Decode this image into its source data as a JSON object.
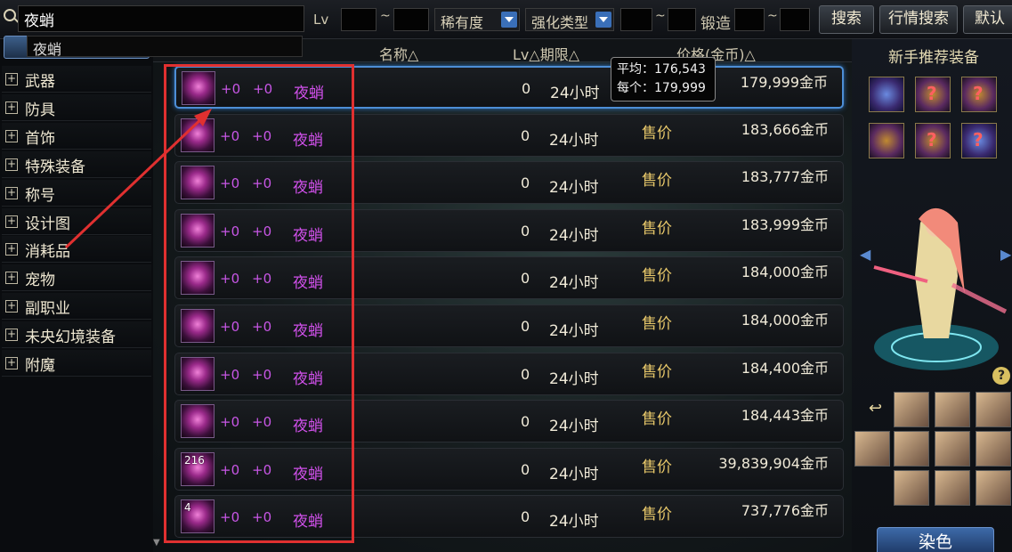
{
  "search": {
    "value": "夜蛸",
    "suggestion": "夜蛸"
  },
  "filters": {
    "lv_label": "Lv",
    "tilde": "~",
    "rarity": "稀有度",
    "enhance_type": "强化类型",
    "forge_label": "锻造",
    "search_btn": "搜索",
    "market_search_btn": "行情搜索",
    "default_btn": "默认"
  },
  "sidebar": {
    "items": [
      {
        "label": "武器"
      },
      {
        "label": "防具"
      },
      {
        "label": "首饰"
      },
      {
        "label": "特殊装备"
      },
      {
        "label": "称号"
      },
      {
        "label": "设计图"
      },
      {
        "label": "消耗品"
      },
      {
        "label": "宠物"
      },
      {
        "label": "副职业"
      },
      {
        "label": "未央幻境装备"
      },
      {
        "label": "附魔"
      }
    ]
  },
  "columns": {
    "name": "名称△",
    "lv_period": "Lv△期限△",
    "price": "价格(金币)△"
  },
  "tooltip": {
    "avg": "平均：176,543",
    "each": "每个：179,999"
  },
  "listings": [
    {
      "qty": "",
      "enh": "+0",
      "forge": "+0",
      "name": "夜蛸",
      "lv": "0",
      "period": "24小时",
      "sale": "",
      "price": "179,999金币"
    },
    {
      "qty": "",
      "enh": "+0",
      "forge": "+0",
      "name": "夜蛸",
      "lv": "0",
      "period": "24小时",
      "sale": "售价",
      "price": "183,666金币"
    },
    {
      "qty": "",
      "enh": "+0",
      "forge": "+0",
      "name": "夜蛸",
      "lv": "0",
      "period": "24小时",
      "sale": "售价",
      "price": "183,777金币"
    },
    {
      "qty": "",
      "enh": "+0",
      "forge": "+0",
      "name": "夜蛸",
      "lv": "0",
      "period": "24小时",
      "sale": "售价",
      "price": "183,999金币"
    },
    {
      "qty": "",
      "enh": "+0",
      "forge": "+0",
      "name": "夜蛸",
      "lv": "0",
      "period": "24小时",
      "sale": "售价",
      "price": "184,000金币"
    },
    {
      "qty": "",
      "enh": "+0",
      "forge": "+0",
      "name": "夜蛸",
      "lv": "0",
      "period": "24小时",
      "sale": "售价",
      "price": "184,000金币"
    },
    {
      "qty": "",
      "enh": "+0",
      "forge": "+0",
      "name": "夜蛸",
      "lv": "0",
      "period": "24小时",
      "sale": "售价",
      "price": "184,400金币"
    },
    {
      "qty": "",
      "enh": "+0",
      "forge": "+0",
      "name": "夜蛸",
      "lv": "0",
      "period": "24小时",
      "sale": "售价",
      "price": "184,443金币"
    },
    {
      "qty": "216",
      "enh": "+0",
      "forge": "+0",
      "name": "夜蛸",
      "lv": "0",
      "period": "24小时",
      "sale": "售价",
      "price": "39,839,904金币"
    },
    {
      "qty": "4",
      "enh": "+0",
      "forge": "+0",
      "name": "夜蛸",
      "lv": "0",
      "period": "24小时",
      "sale": "售价",
      "price": "737,776金币"
    }
  ],
  "right_panel": {
    "title": "新手推荐装备",
    "dye_btn": "染色",
    "help": "?"
  },
  "colors": {
    "highlight": "#e03030",
    "item_name": "#d050ea",
    "sale_label": "#e8c86a",
    "selected_border": "#4d8ed6"
  }
}
